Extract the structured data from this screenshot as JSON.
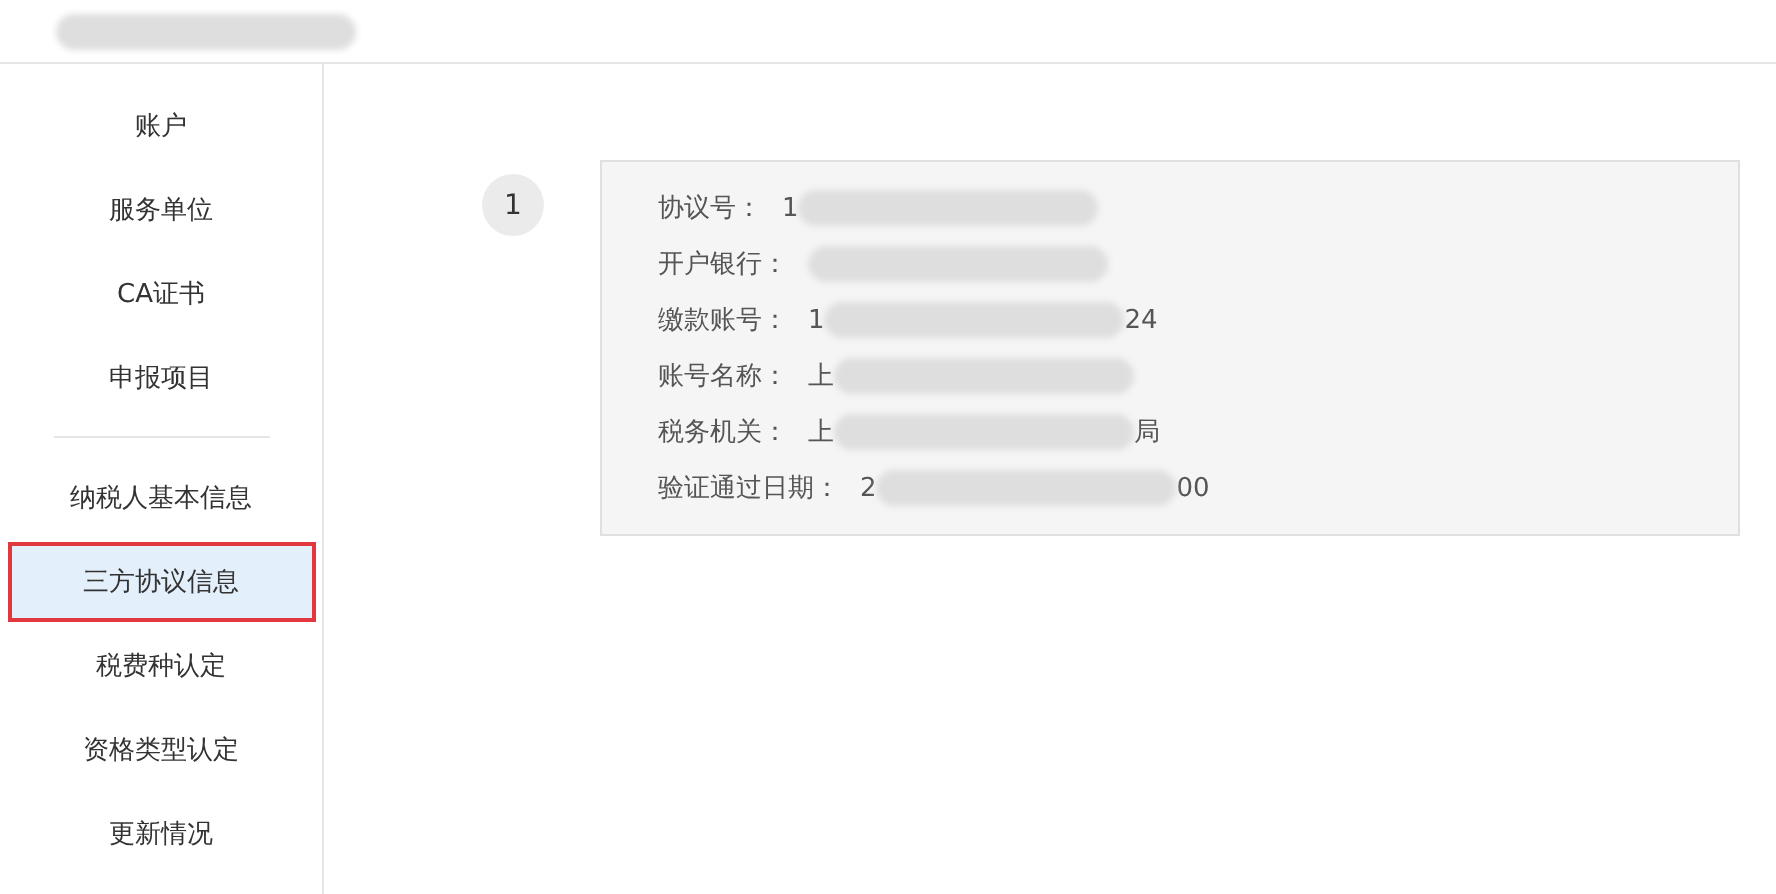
{
  "sidebar": {
    "groups": [
      {
        "items": [
          {
            "label": "账户",
            "selected": false
          },
          {
            "label": "服务单位",
            "selected": false
          },
          {
            "label": "CA证书",
            "selected": false
          },
          {
            "label": "申报项目",
            "selected": false
          }
        ]
      },
      {
        "items": [
          {
            "label": "纳税人基本信息",
            "selected": false
          },
          {
            "label": "三方协议信息",
            "selected": true
          },
          {
            "label": "税费种认定",
            "selected": false
          },
          {
            "label": "资格类型认定",
            "selected": false
          },
          {
            "label": "更新情况",
            "selected": false
          }
        ]
      }
    ]
  },
  "agreements": [
    {
      "index": "1",
      "fields": [
        {
          "label": "协议号：",
          "value_start": "1"
        },
        {
          "label": "开户银行："
        },
        {
          "label": "缴款账号：",
          "value_start": "1",
          "value_end": "24"
        },
        {
          "label": "账号名称：",
          "value_start": "上"
        },
        {
          "label": "税务机关：",
          "value_start": "上",
          "value_end": "局"
        },
        {
          "label": "验证通过日期：",
          "value_start": "2",
          "value_end": "00"
        }
      ]
    }
  ]
}
